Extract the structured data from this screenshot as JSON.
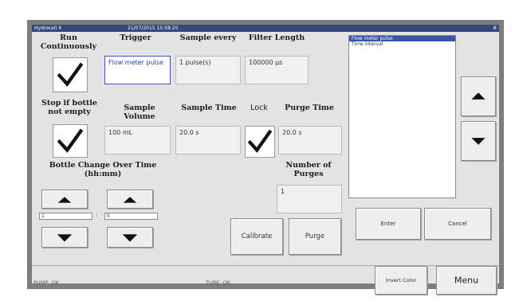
{
  "window": {
    "title": "Hydrocell 4",
    "datetime": "21/07/2015 15:58:20",
    "close_label": "x"
  },
  "labels": {
    "run_continuously": "Run Continuously",
    "trigger": "Trigger",
    "sample_every": "Sample every",
    "filter_length": "Filter Length",
    "stop_if_bottle": "Stop if bottle not empty",
    "sample_volume": "Sample Volume",
    "sample_time": "Sample Time",
    "lock": "Lock",
    "purge_time": "Purge Time",
    "bottle_change": "Bottle Change Over Time (hh:mm)",
    "number_of_purges": "Number of Purges"
  },
  "fields": {
    "trigger": "Flow meter pulse",
    "sample_every": "1 pulse(s)",
    "filter_length": "100000 µs",
    "sample_volume": "100 mL",
    "sample_time": "20.0 s",
    "purge_time": "20.0 s",
    "number_of_purges": "1",
    "hours": "1",
    "minutes": "0",
    "time_separator": ":"
  },
  "checkboxes": {
    "run_continuously": true,
    "stop_if_bottle": true,
    "lock": true
  },
  "list": {
    "items": [
      {
        "label": "Flow meter pulse",
        "selected": true
      },
      {
        "label": "Time interval",
        "selected": false
      }
    ]
  },
  "buttons": {
    "calibrate": "Calibrate",
    "purge": "Purge",
    "enter": "Enter",
    "cancel": "Cancel",
    "invert_color": "Invert Color",
    "menu": "Menu"
  },
  "status": {
    "pump": "PUMP: OK",
    "tube": "TUBE: OK"
  },
  "icons": [
    "check-icon",
    "triangle-up-icon",
    "triangle-down-icon",
    "close-icon"
  ]
}
